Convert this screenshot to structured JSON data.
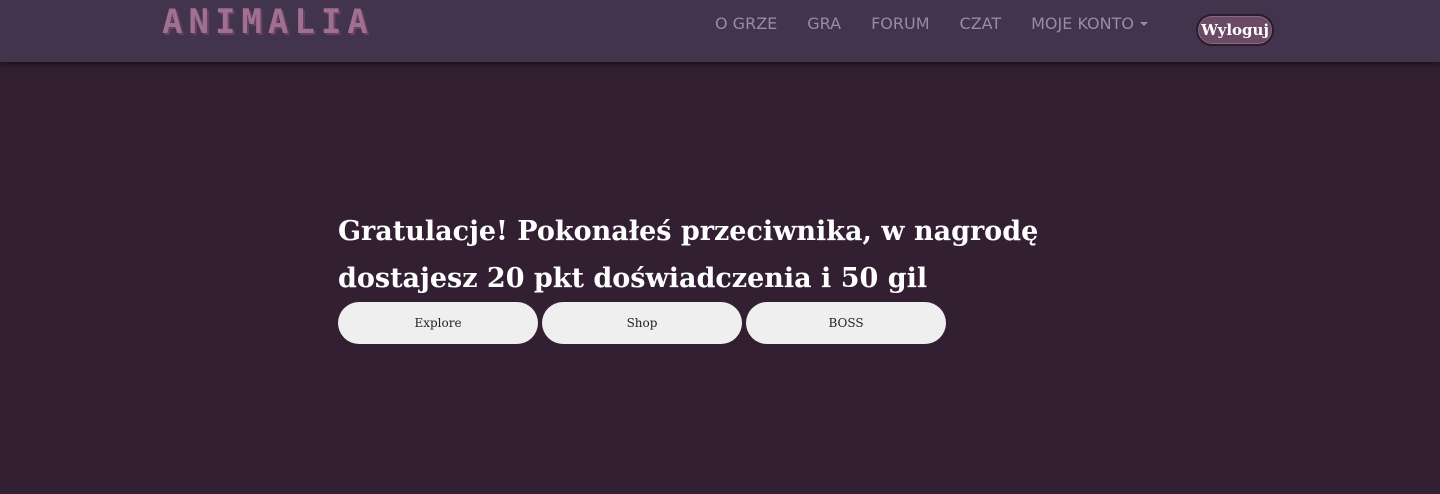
{
  "header": {
    "logo_text": "ANIMALIA",
    "nav": [
      "O GRZE",
      "GRA",
      "FORUM",
      "CZAT",
      "MOJE KONTO"
    ],
    "logout_label": "Wyloguj"
  },
  "main": {
    "message": "Gratulacje! Pokonałeś przeciwnika, w nagrodę dostajesz 20 pkt doświadczenia i 50 gil",
    "buttons": [
      "Explore",
      "Shop",
      "BOSS"
    ]
  },
  "colors": {
    "page_background": "#321f31",
    "navbar_background": "#42344c",
    "nav_text": "#9a8aa3",
    "logo": "#a07090",
    "logout_button": "#6b4a66",
    "action_button": "#efefef"
  },
  "icons": {
    "account_dropdown": "caret-down-icon"
  }
}
